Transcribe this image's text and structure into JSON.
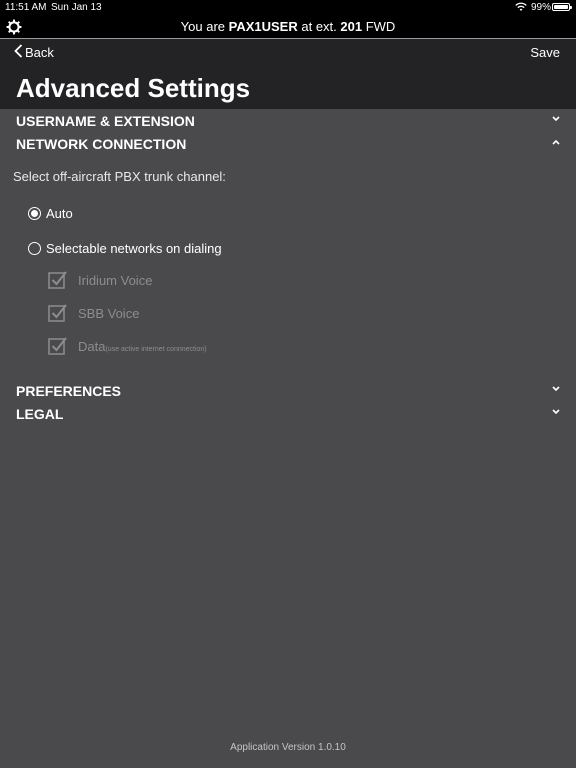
{
  "status": {
    "time": "11:51 AM",
    "date": "Sun Jan 13",
    "battery": "99%"
  },
  "ext_bar": {
    "prefix": "You are ",
    "username": "PAX1USER",
    "middle": " at ext. ",
    "extension": "201",
    "suffix": " FWD"
  },
  "header": {
    "back_label": "Back",
    "save_label": "Save",
    "title": "Advanced Settings"
  },
  "sections": {
    "username_extension": "USERNAME & EXTENSION",
    "network_connection": "NETWORK CONNECTION",
    "preferences": "PREFERENCES",
    "legal": "LEGAL"
  },
  "network": {
    "prompt": "Select off-aircraft PBX trunk channel:",
    "options": [
      {
        "label": "Auto",
        "selected": true
      },
      {
        "label": "Selectable networks on dialing",
        "selected": false
      }
    ],
    "networks": [
      {
        "label": "Iridium Voice",
        "sub": "",
        "checked": true
      },
      {
        "label": "SBB Voice",
        "sub": "",
        "checked": true
      },
      {
        "label": "Data",
        "sub": "(use active internet connnection)",
        "checked": true
      }
    ]
  },
  "footer": {
    "version": "Application Version 1.0.10"
  },
  "icons": {
    "settings": "gear-icon",
    "back": "chevron-left-icon",
    "collapsed": "chevron-down-icon",
    "expanded": "chevron-up-icon",
    "check": "checkbox-checked-icon",
    "wifi": "wifi-icon",
    "battery": "battery-icon"
  },
  "colors": {
    "background": "#4a4a4d",
    "header": "#232325",
    "bar": "#000000",
    "disabled_text": "#8d8d8f"
  }
}
